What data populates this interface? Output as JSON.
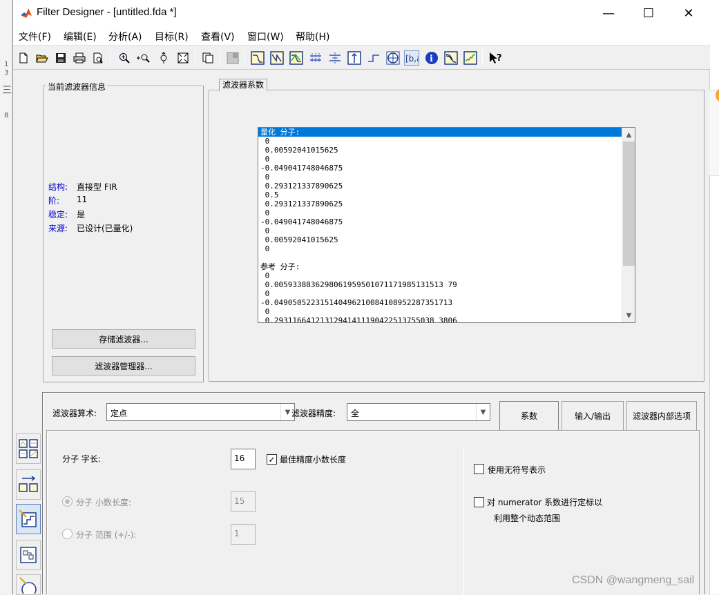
{
  "window": {
    "title": "Filter Designer -  [untitled.fda *]",
    "minimize": "—",
    "maximize": "☐",
    "close": "✕"
  },
  "menu": [
    "文件(F)",
    "编辑(E)",
    "分析(A)",
    "目标(R)",
    "查看(V)",
    "窗口(W)",
    "帮助(H)"
  ],
  "toolbar_icons": [
    "new-icon",
    "open-icon",
    "save-icon",
    "print-icon",
    "print-preview-icon",
    "zoom-in-icon",
    "zoom-x-icon",
    "zoom-y-icon",
    "full-view-icon",
    "new-window-icon",
    "legend-icon",
    "magnitude-response-icon",
    "phase-response-icon",
    "magnitude-phase-icon",
    "group-delay-icon",
    "phase-delay-icon",
    "impulse-response-icon",
    "step-response-icon",
    "pole-zero-icon",
    "filter-coefficients-icon",
    "filter-info-icon",
    "magnitude-estimate-icon",
    "round-off-noise-icon",
    "whats-this-icon"
  ],
  "background": {
    "left_glyphs": [
      "1",
      "3",
      "三",
      "8"
    ]
  },
  "info_panel": {
    "title": "当前滤波器信息",
    "rows": [
      {
        "label": "结构:",
        "value": "直接型 FIR"
      },
      {
        "label": "阶:",
        "value": "11"
      },
      {
        "label": "稳定:",
        "value": "是"
      },
      {
        "label": "来源:",
        "value": "已设计(已量化)"
      }
    ],
    "store_button": "存储滤波器...",
    "manager_button": "滤波器管理器..."
  },
  "coef_panel": {
    "title": "滤波器系数",
    "lines": [
      "量化 分子:",
      " 0",
      " 0.00592041015625",
      " 0",
      "-0.049041748046875",
      " 0",
      " 0.293121337890625",
      " 0.5",
      " 0.293121337890625",
      " 0",
      "-0.049041748046875",
      " 0",
      " 0.00592041015625",
      " 0",
      "",
      "参考 分子:",
      " 0",
      " 0.0059338836298061959501071171985131513 79",
      " 0",
      "-0.049050522315140496210084108952287351713",
      " 0",
      " 0.29311664121312941411190422513755038 3806"
    ]
  },
  "settings": {
    "arithmetic_label": "滤波器算术:",
    "arithmetic_value": "定点",
    "precision_label": "滤波器精度:",
    "precision_value": "全",
    "tabs": [
      "系数",
      "输入/输出",
      "滤波器内部选项"
    ],
    "numerator_wordlength_label": "分子 字长:",
    "numerator_wordlength_value": "16",
    "best_precision_label": "最佳精度小数长度",
    "best_precision_checked": true,
    "frac_length_label": "分子 小数长度:",
    "frac_length_value": "15",
    "range_label": "分子 范围 (+/-):",
    "range_value": "1",
    "unsigned_label": "使用无符号表示",
    "scale_label_line1": "对 numerator 系数进行定标以",
    "scale_label_line2": "利用整个动态范围"
  },
  "watermark": "CSDN @wangmeng_sail"
}
